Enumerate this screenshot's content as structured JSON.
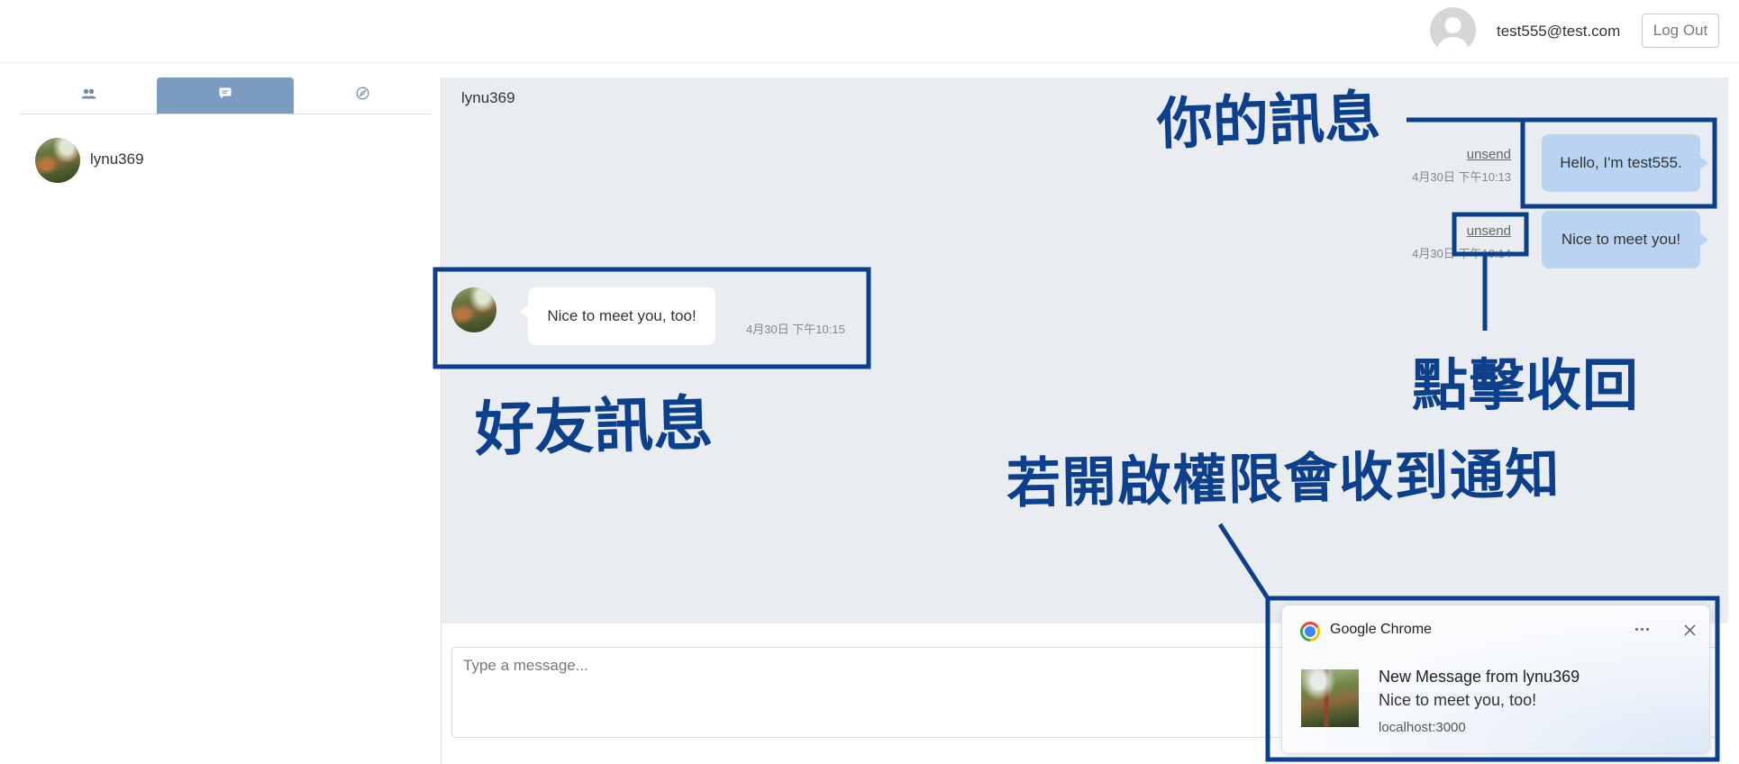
{
  "header": {
    "avatar_icon": "default-avatar-icon",
    "user_email": "test555@test.com",
    "logout_label": "Log Out"
  },
  "sidebar": {
    "tabs": [
      {
        "icon": "friends-icon",
        "active": false
      },
      {
        "icon": "chat-icon",
        "active": true
      },
      {
        "icon": "compass-icon",
        "active": false
      }
    ],
    "contacts": [
      {
        "name": "lynu369"
      }
    ]
  },
  "chat": {
    "title": "lynu369",
    "messages": [
      {
        "side": "right",
        "text": "Hello, I'm test555.",
        "action": "unsend",
        "time": "4月30日 下午10:13"
      },
      {
        "side": "right",
        "text": "Nice to meet you!",
        "action": "unsend",
        "time": "4月30日 下午10:14"
      },
      {
        "side": "left",
        "text": "Nice to meet you, too!",
        "time": "4月30日 下午10:15"
      }
    ],
    "input_placeholder": "Type a message..."
  },
  "notification": {
    "app": "Google Chrome",
    "app_icon": "chrome-icon",
    "more_icon": "more-icon",
    "close_icon": "close-icon",
    "title": "New Message from lynu369",
    "body": "Nice to meet you, too!",
    "source": "localhost:3000"
  },
  "annotations": {
    "my_message": "你的訊息",
    "click_unsend": "點擊收回",
    "friend_message": "好友訊息",
    "notification_hint": "若開啟權限會收到通知"
  },
  "colors": {
    "accent_tab": "#7b9cc0",
    "my_bubble": "#b8d4f2",
    "chat_background": "#e9ecf0",
    "annotation_ink": "#0c3f8c"
  }
}
